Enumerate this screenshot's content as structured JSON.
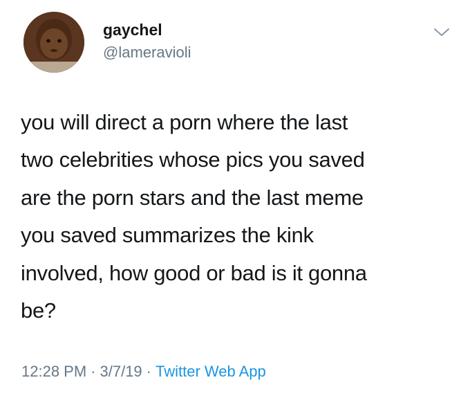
{
  "user": {
    "display_name": "gaychel",
    "handle": "@lameravioli"
  },
  "tweet": {
    "lines": [
      "you will direct a porn where the last",
      "two celebrities whose pics you saved",
      "are the porn stars and the last meme",
      "you saved summarizes the kink",
      "involved, how good or bad is it gonna",
      "be?"
    ]
  },
  "meta": {
    "time": "12:28 PM",
    "separator": "·",
    "date": "3/7/19",
    "source": "Twitter Web App"
  },
  "icons": {
    "avatar": "avatar-photo",
    "menu": "chevron-down-icon"
  },
  "colors": {
    "text": "#14171a",
    "secondary": "#657786",
    "link": "#1b95e0",
    "background": "#ffffff"
  }
}
